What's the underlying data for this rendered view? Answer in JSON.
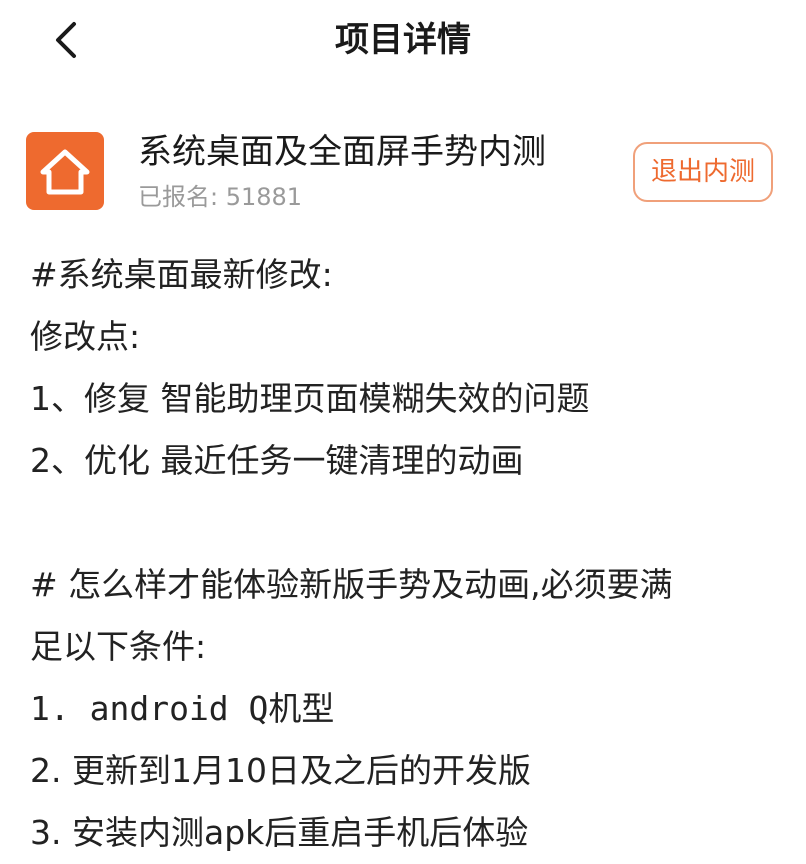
{
  "header": {
    "back_icon": "chevron-left-icon",
    "title": "项目详情"
  },
  "project": {
    "icon": "home-icon",
    "icon_color": "#ee6a2f",
    "name": "系统桌面及全面屏手势内测",
    "signup_label": "已报名: 51881",
    "exit_button": "退出内测"
  },
  "content": {
    "lines": [
      "#系统桌面最新修改:",
      "修改点:",
      "1、修复  智能助理页面模糊失效的问题",
      "2、优化  最近任务一键清理的动画",
      "",
      "#  怎么样才能体验新版手势及动画,必须要满",
      "足以下条件:",
      "1. android Q机型",
      "2. 更新到1月10日及之后的开发版",
      "3. 安装内测apk后重启手机后体验"
    ]
  }
}
